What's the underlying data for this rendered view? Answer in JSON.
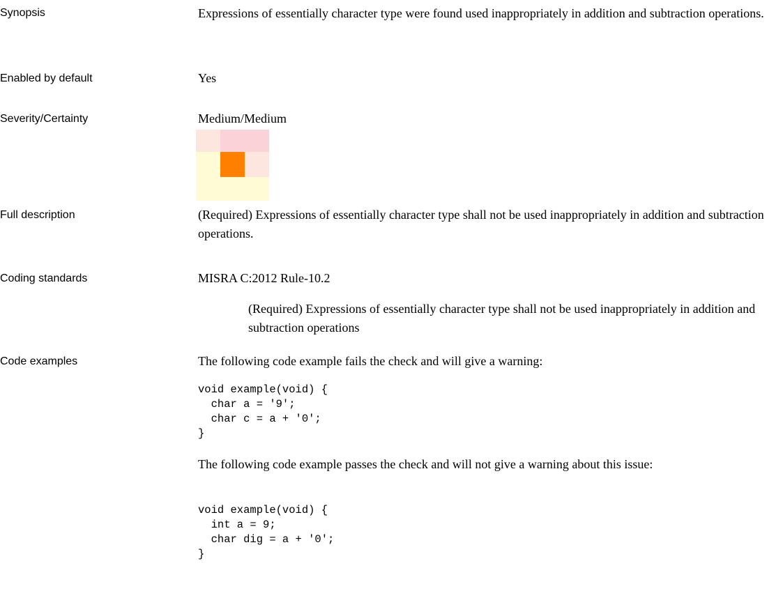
{
  "rows": {
    "synopsis": {
      "label": "Synopsis",
      "text": "Expressions of essentially character type were found used inappropriately in addition and subtraction operations."
    },
    "enabled": {
      "label": "Enabled by default",
      "text": "Yes"
    },
    "severity": {
      "label": "Severity/Certainty",
      "text": "Medium/Medium"
    },
    "full_description": {
      "label": "Full description",
      "text": "(Required) Expressions of essentially character type shall not be used inappropriately in addition and subtraction operations."
    },
    "coding_standards": {
      "label": "Coding standards",
      "standard": "MISRA C:2012 Rule-10.2",
      "detail": "(Required) Expressions of essentially character type shall not be used inappropriately in addition and subtraction operations"
    },
    "code_examples": {
      "label": "Code examples",
      "fail_intro": "The following code example fails the check and will give a warning:",
      "fail_code": "void example(void) {\n  char a = '9';\n  char c = a + '0';\n}",
      "pass_intro": "The following code example passes the check and will not give a warning about this issue:",
      "pass_code": "void example(void) {\n  int a = 9;\n  char dig = a + '0';\n}"
    }
  },
  "severity_matrix": {
    "cells": [
      [
        "#fde6de",
        "#fbd2d8",
        "#fbd2d8"
      ],
      [
        "#fffbd5",
        "#ff7f00",
        "#fde6de"
      ],
      [
        "#fffbd5",
        "#fffbd5",
        "#fffbd5"
      ]
    ]
  }
}
